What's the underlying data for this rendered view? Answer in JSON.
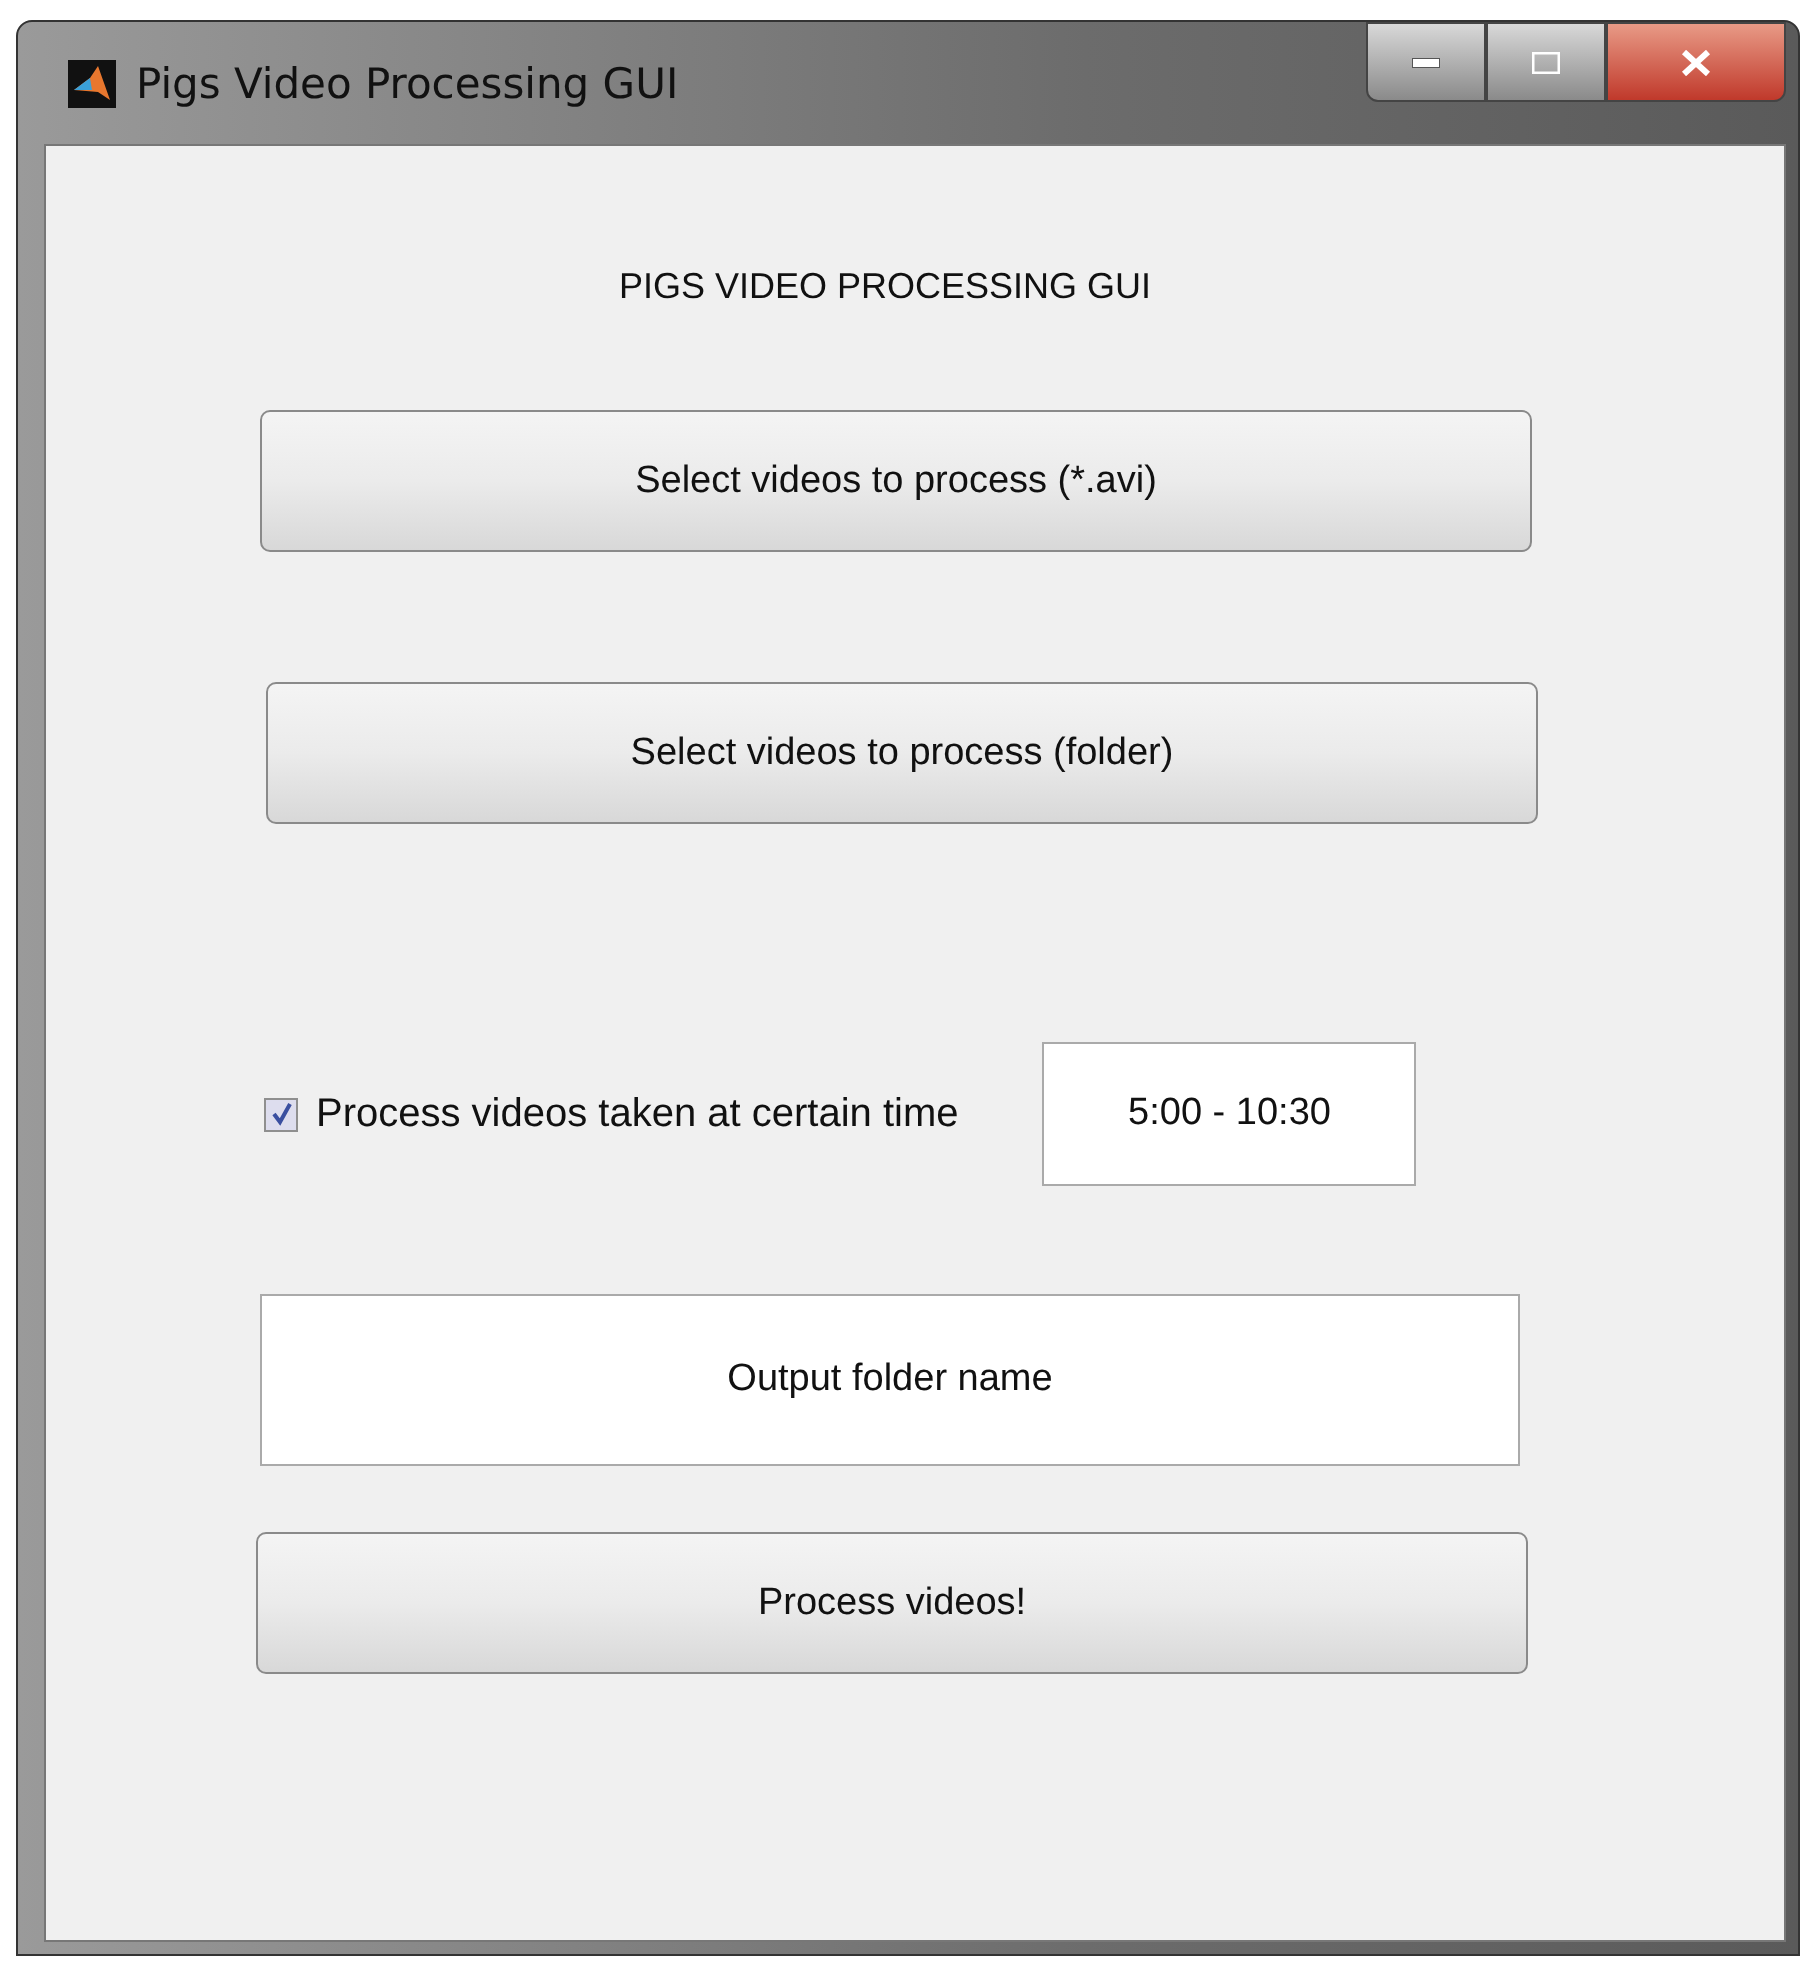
{
  "window": {
    "title": "Pigs Video Processing GUI"
  },
  "heading": "PIGS VIDEO PROCESSING GUI",
  "select_files_button": "Select videos to process (*.avi)",
  "select_folder_button": "Select videos to process (folder)",
  "time_filter": {
    "label": "Process videos taken at certain time",
    "checked": true,
    "value": "5:00 - 10:30"
  },
  "output_folder": {
    "value": "Output folder name"
  },
  "process_button": "Process videos!"
}
